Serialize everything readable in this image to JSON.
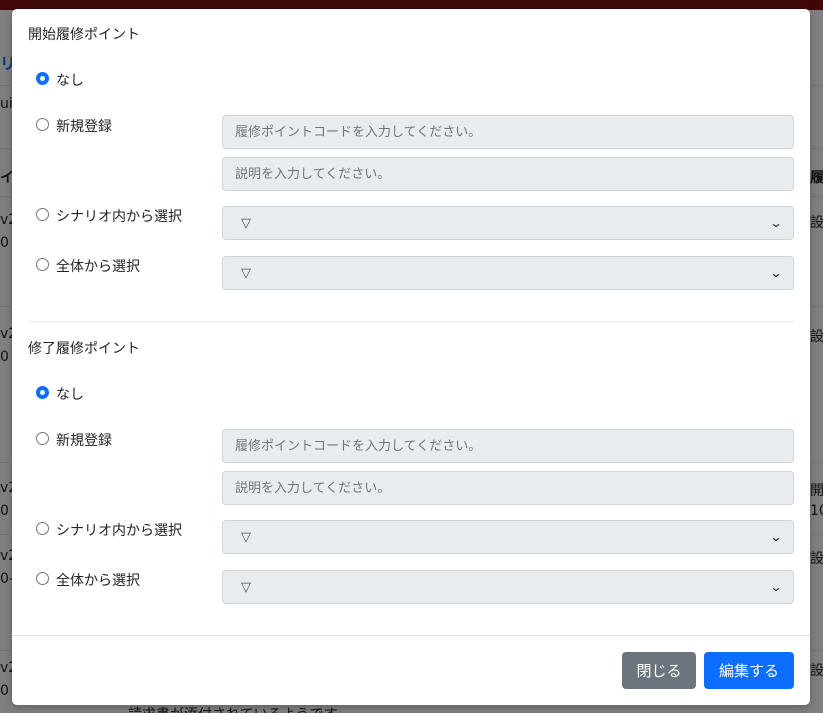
{
  "background": {
    "link_text": "リス",
    "tab_text": "ui",
    "col_header_left": "イ-",
    "col_header_right": "履",
    "rows": [
      {
        "left_a": "v2",
        "left_b": "0",
        "right_a": "設",
        "right_b": ""
      },
      {
        "left_a": "v2",
        "left_b": "0",
        "right_a": "設",
        "right_b": ""
      },
      {
        "left_a": "v2",
        "left_b": "0",
        "right_a": "開",
        "right_b": "10"
      },
      {
        "left_a": "v2",
        "left_b": "0-",
        "right_a": "設",
        "right_b": ""
      },
      {
        "left_a": "v2",
        "left_b": "0",
        "right_a": "設",
        "right_b": ""
      }
    ],
    "bottom_text": "請求書が添付されているようです"
  },
  "modal": {
    "start_section": {
      "title": "開始履修ポイント",
      "option_none": "なし",
      "option_new": "新規登録",
      "code_placeholder": "履修ポイントコードを入力してください。",
      "desc_placeholder": "説明を入力してください。",
      "option_scenario": "シナリオ内から選択",
      "scenario_select_value": "▽",
      "option_all": "全体から選択",
      "all_select_value": "▽",
      "selected": "none"
    },
    "end_section": {
      "title": "修了履修ポイント",
      "option_none": "なし",
      "option_new": "新規登録",
      "code_placeholder": "履修ポイントコードを入力してください。",
      "desc_placeholder": "説明を入力してください。",
      "option_scenario": "シナリオ内から選択",
      "scenario_select_value": "▽",
      "option_all": "全体から選択",
      "all_select_value": "▽",
      "selected": "none"
    },
    "footer": {
      "close_label": "閉じる",
      "edit_label": "編集する"
    }
  },
  "colors": {
    "primary": "#0d6efd",
    "secondary": "#6c757d",
    "topbar": "#7d1010"
  }
}
